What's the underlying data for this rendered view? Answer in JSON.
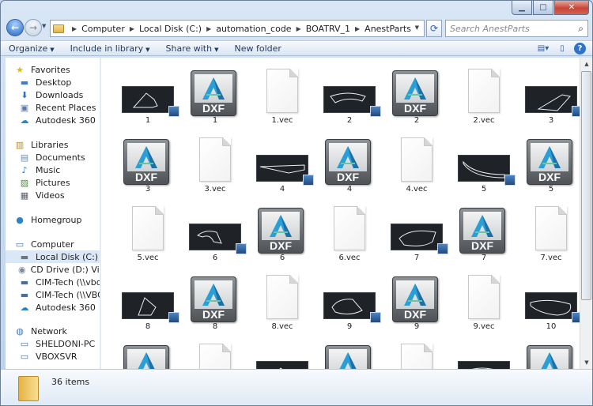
{
  "breadcrumb": [
    "Computer",
    "Local Disk (C:)",
    "automation_code",
    "BOATRV_1",
    "AnestParts"
  ],
  "search": {
    "placeholder": "Search AnestParts"
  },
  "toolbar": {
    "organize": "Organize",
    "include": "Include in library",
    "share": "Share with",
    "new_folder": "New folder"
  },
  "sidebar": {
    "favorites": "Favorites",
    "fav_items": [
      "Desktop",
      "Downloads",
      "Recent Places",
      "Autodesk 360"
    ],
    "libraries": "Libraries",
    "lib_items": [
      "Documents",
      "Music",
      "Pictures",
      "Videos"
    ],
    "homegroup": "Homegroup",
    "computer": "Computer",
    "comp_items": [
      "Local Disk (C:)",
      "CD Drive (D:) Virtual",
      "CIM-Tech (\\\\vboxsr",
      "CIM-Tech (\\\\VBOXS",
      "Autodesk 360"
    ],
    "network": "Network",
    "net_items": [
      "SHELDONI-PC",
      "VBOXSVR"
    ]
  },
  "files": [
    {
      "label": "1",
      "kind": "thumb"
    },
    {
      "label": "1",
      "kind": "dxf"
    },
    {
      "label": "1.vec",
      "kind": "vec"
    },
    {
      "label": "2",
      "kind": "thumb"
    },
    {
      "label": "2",
      "kind": "dxf"
    },
    {
      "label": "2.vec",
      "kind": "vec"
    },
    {
      "label": "3",
      "kind": "thumb"
    },
    {
      "label": "3",
      "kind": "dxf"
    },
    {
      "label": "3.vec",
      "kind": "vec"
    },
    {
      "label": "4",
      "kind": "thumb"
    },
    {
      "label": "4",
      "kind": "dxf"
    },
    {
      "label": "4.vec",
      "kind": "vec"
    },
    {
      "label": "5",
      "kind": "thumb"
    },
    {
      "label": "5",
      "kind": "dxf"
    },
    {
      "label": "5.vec",
      "kind": "vec"
    },
    {
      "label": "6",
      "kind": "thumb"
    },
    {
      "label": "6",
      "kind": "dxf"
    },
    {
      "label": "6.vec",
      "kind": "vec"
    },
    {
      "label": "7",
      "kind": "thumb"
    },
    {
      "label": "7",
      "kind": "dxf"
    },
    {
      "label": "7.vec",
      "kind": "vec"
    },
    {
      "label": "8",
      "kind": "thumb"
    },
    {
      "label": "8",
      "kind": "dxf"
    },
    {
      "label": "8.vec",
      "kind": "vec"
    },
    {
      "label": "9",
      "kind": "thumb"
    },
    {
      "label": "9",
      "kind": "dxf"
    },
    {
      "label": "9.vec",
      "kind": "vec"
    },
    {
      "label": "10",
      "kind": "thumb"
    },
    {
      "label": "",
      "kind": "dxf"
    },
    {
      "label": "",
      "kind": "vec"
    },
    {
      "label": "",
      "kind": "thumb"
    },
    {
      "label": "",
      "kind": "dxf"
    },
    {
      "label": "",
      "kind": "vec"
    },
    {
      "label": "",
      "kind": "thumb"
    },
    {
      "label": "",
      "kind": "dxf"
    }
  ],
  "dxf_text": "DXF",
  "status": {
    "count": "36 items"
  }
}
